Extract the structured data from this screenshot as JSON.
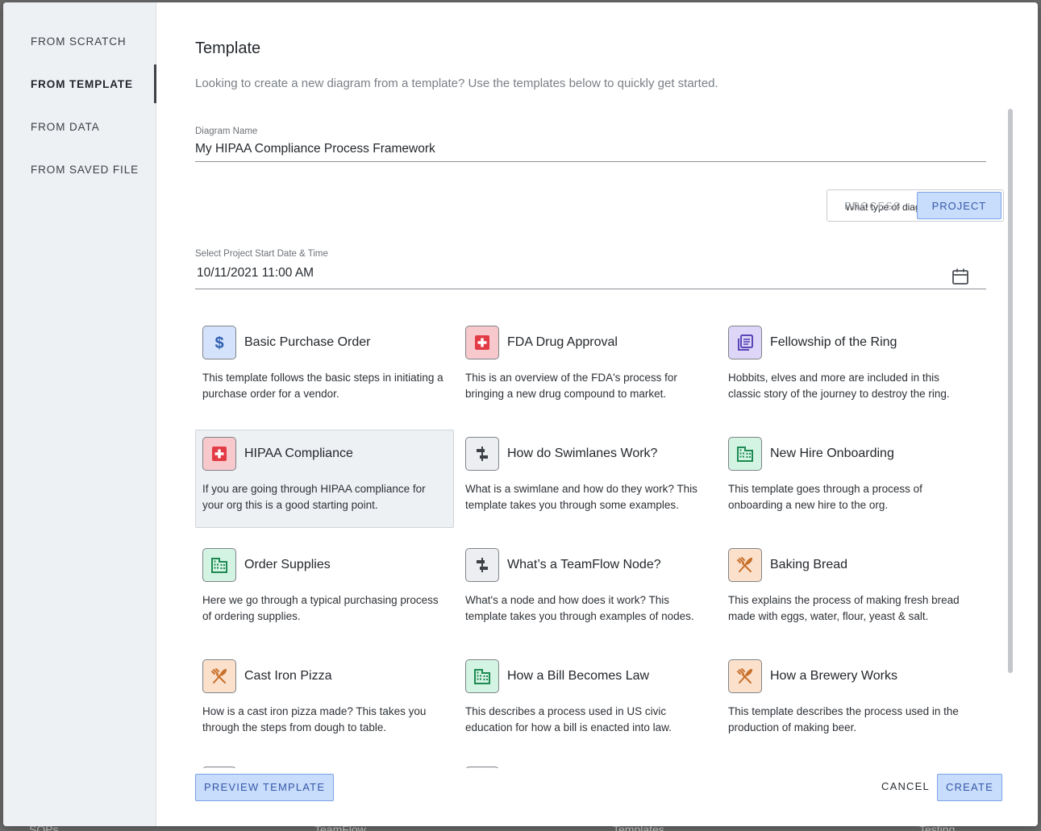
{
  "backdrop": {
    "texts": [
      "SOPs",
      "TeamFlow",
      "Templates",
      "Testing"
    ]
  },
  "sidebar": {
    "items": [
      {
        "label": "FROM SCRATCH",
        "active": false
      },
      {
        "label": "FROM TEMPLATE",
        "active": true
      },
      {
        "label": "FROM DATA",
        "active": false
      },
      {
        "label": "FROM SAVED FILE",
        "active": false
      }
    ]
  },
  "main": {
    "title": "Template",
    "subtitle": "Looking to create a new diagram from a template? Use the templates below to quickly get started."
  },
  "form": {
    "diagram_name_label": "Diagram Name",
    "diagram_name_value": "My HIPAA Compliance Process Framework",
    "type_question": "What type of diagram is this?",
    "type_options": [
      "PROCESS",
      "PROJECT"
    ],
    "type_selected": "PROJECT",
    "start_label": "Select Project Start Date & Time",
    "start_value": "10/11/2021 11:00 AM"
  },
  "templates": [
    {
      "title": "Basic Purchase Order",
      "desc": "This template follows the basic steps in initiating a purchase order for a vendor.",
      "icon": "dollar-icon",
      "color": "#d4e3fb",
      "glyph_color": "#2f5fb0",
      "selected": false
    },
    {
      "title": "FDA Drug Approval",
      "desc": "This is an overview of the FDA's process for bringing a new drug compound to market.",
      "icon": "medical-cross-icon",
      "color": "#f7c9cc",
      "glyph_color": "#e23b46",
      "selected": false
    },
    {
      "title": "Fellowship of the Ring",
      "desc": "Hobbits, elves and more are included in this classic story of the journey to destroy the ring.",
      "icon": "book-stack-icon",
      "color": "#ddd6f8",
      "glyph_color": "#5a45b8",
      "selected": false
    },
    {
      "title": "HIPAA Compliance",
      "desc": "If you are going through HIPAA compliance for your org this is a good starting point.",
      "icon": "medical-cross-icon",
      "color": "#f7c9cc",
      "glyph_color": "#e23b46",
      "selected": true
    },
    {
      "title": "How do Swimlanes Work?",
      "desc": "What is a swimlane and how do they work? This template takes you through some examples.",
      "icon": "align-center-icon",
      "color": "#eceef1",
      "glyph_color": "#3d4147",
      "selected": false
    },
    {
      "title": "New Hire Onboarding",
      "desc": "This template goes through a process of onboarding a new hire to the org.",
      "icon": "building-icon",
      "color": "#d3f3e3",
      "glyph_color": "#1c8a52",
      "selected": false
    },
    {
      "title": "Order Supplies",
      "desc": "Here we go through a typical purchasing process of ordering supplies.",
      "icon": "building-icon",
      "color": "#d3f3e3",
      "glyph_color": "#1c8a52",
      "selected": false
    },
    {
      "title": "What’s a TeamFlow Node?",
      "desc": "What's a node and how does it work? This template takes you through examples of nodes.",
      "icon": "align-center-icon",
      "color": "#eceef1",
      "glyph_color": "#3d4147",
      "selected": false
    },
    {
      "title": "Baking Bread",
      "desc": "This explains the process of making fresh bread made with eggs, water, flour, yeast & salt.",
      "icon": "utensils-icon",
      "color": "#fbe0cc",
      "glyph_color": "#c8702a",
      "selected": false
    },
    {
      "title": "Cast Iron Pizza",
      "desc": "How is a cast iron pizza made? This takes you through the steps from dough to table.",
      "icon": "utensils-icon",
      "color": "#fbe0cc",
      "glyph_color": "#c8702a",
      "selected": false
    },
    {
      "title": "How a Bill Becomes Law",
      "desc": "This describes a process used in US civic education for how a bill is enacted into law.",
      "icon": "building-icon",
      "color": "#d3f3e3",
      "glyph_color": "#1c8a52",
      "selected": false
    },
    {
      "title": "How a Brewery Works",
      "desc": "This template describes the process used in the production of making beer.",
      "icon": "utensils-icon",
      "color": "#fbe0cc",
      "glyph_color": "#c8702a",
      "selected": false
    }
  ],
  "footer": {
    "preview_label": "PREVIEW TEMPLATE",
    "cancel_label": "CANCEL",
    "create_label": "CREATE"
  },
  "colors": {
    "accent": "#c8dcfb",
    "accent_border": "#7ba2e6",
    "accent_text": "#3659a8",
    "sidebar_bg": "#eef1f4"
  }
}
